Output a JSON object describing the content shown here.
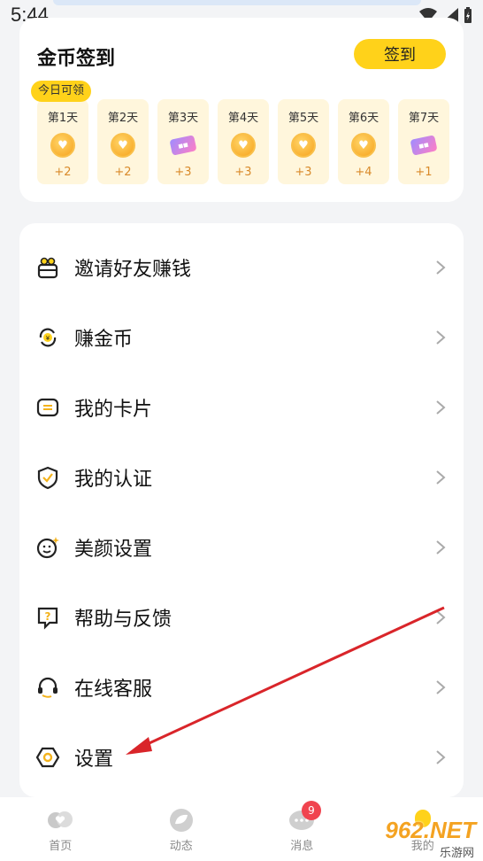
{
  "status_bar": {
    "time": "5:44"
  },
  "signin": {
    "title": "金币签到",
    "button_label": "签到",
    "today_badge": "今日可领",
    "days": [
      {
        "label": "第1天",
        "reward": "+2",
        "icon": "coin-icon"
      },
      {
        "label": "第2天",
        "reward": "+2",
        "icon": "coin-icon"
      },
      {
        "label": "第3天",
        "reward": "+3",
        "icon": "ticket-icon"
      },
      {
        "label": "第4天",
        "reward": "+3",
        "icon": "coin-icon"
      },
      {
        "label": "第5天",
        "reward": "+3",
        "icon": "coin-icon"
      },
      {
        "label": "第6天",
        "reward": "+4",
        "icon": "coin-icon"
      },
      {
        "label": "第7天",
        "reward": "+1",
        "icon": "ticket-icon"
      }
    ]
  },
  "menu": {
    "items": [
      {
        "label": "邀请好友赚钱",
        "icon": "gift-icon"
      },
      {
        "label": "赚金币",
        "icon": "coin-exchange-icon"
      },
      {
        "label": "我的卡片",
        "icon": "card-icon"
      },
      {
        "label": "我的认证",
        "icon": "shield-check-icon"
      },
      {
        "label": "美颜设置",
        "icon": "face-sparkle-icon"
      },
      {
        "label": "帮助与反馈",
        "icon": "help-chat-icon"
      },
      {
        "label": "在线客服",
        "icon": "headset-icon"
      },
      {
        "label": "设置",
        "icon": "settings-hexagon-icon"
      }
    ]
  },
  "bottom_nav": {
    "items": [
      {
        "label": "首页",
        "icon": "home-hearts-icon"
      },
      {
        "label": "动态",
        "icon": "leaf-icon"
      },
      {
        "label": "消息",
        "icon": "chat-bubbles-icon",
        "badge": "9"
      },
      {
        "label": "我的",
        "icon": "profile-icon"
      }
    ]
  },
  "watermark": {
    "text": "962.NET",
    "sub": "乐游网"
  },
  "colors": {
    "accent": "#ffd21a",
    "reward": "#d98a2a",
    "badge": "#f0444f",
    "arrow": "#d9252a"
  }
}
